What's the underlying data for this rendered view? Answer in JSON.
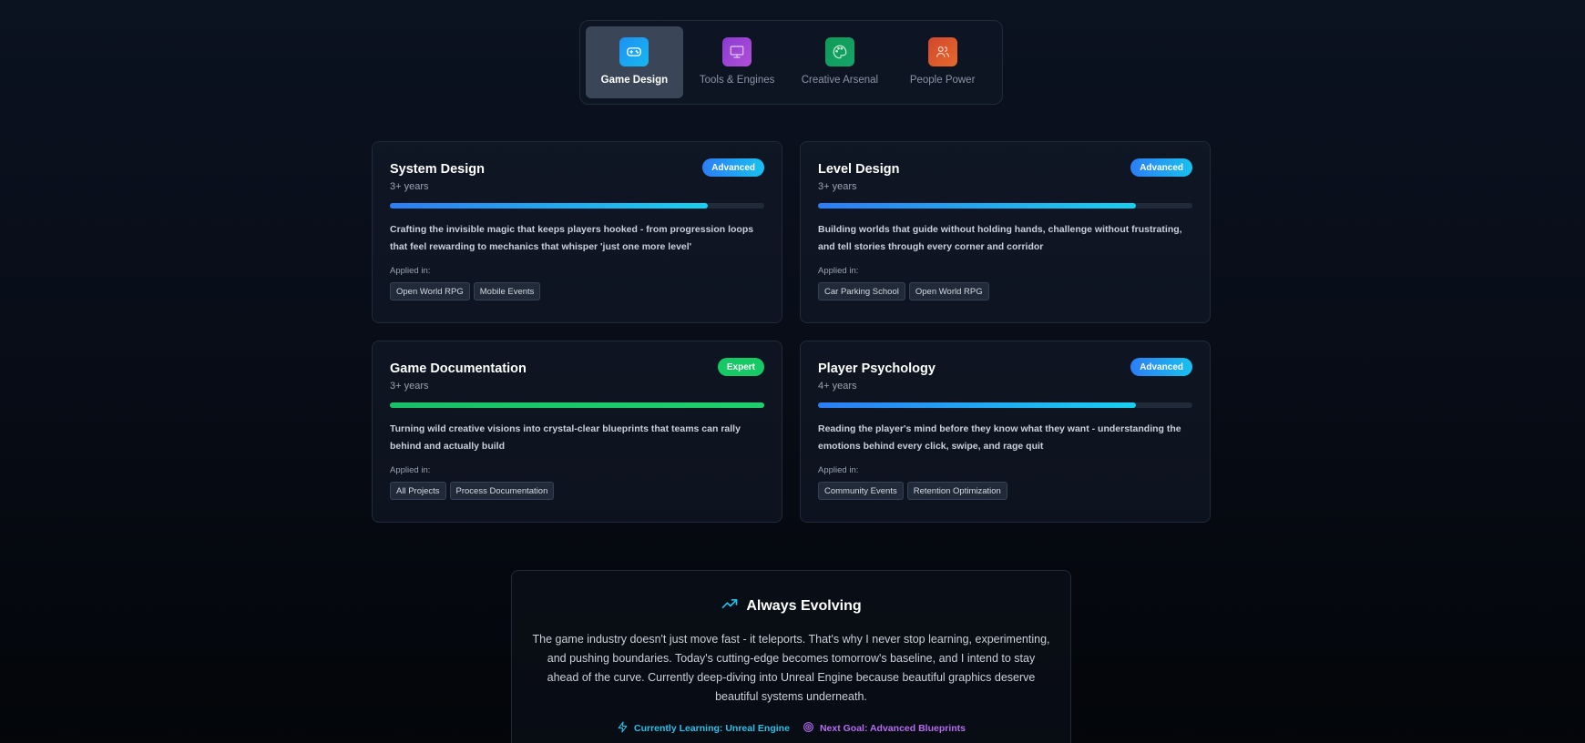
{
  "tabs": [
    {
      "label": "Game Design",
      "icon": "gamepad-icon",
      "color_from": "#1e90f5",
      "color_to": "#17b8ee",
      "active": true
    },
    {
      "label": "Tools & Engines",
      "icon": "monitor-icon",
      "color_from": "#8a3bd1",
      "color_to": "#b14fd8",
      "active": false
    },
    {
      "label": "Creative Arsenal",
      "icon": "palette-icon",
      "color_from": "#0f9a55",
      "color_to": "#15a56a",
      "active": false
    },
    {
      "label": "People Power",
      "icon": "users-icon",
      "color_from": "#d2462f",
      "color_to": "#e56a2a",
      "active": false
    }
  ],
  "skills": [
    {
      "title": "System Design",
      "years": "3+ years",
      "level": "Advanced",
      "progress": 0.85,
      "description": "Crafting the invisible magic that keeps players hooked - from progression loops that feel rewarding to mechanics that whisper 'just one more level'",
      "applied_label": "Applied in:",
      "tags": [
        "Open World RPG",
        "Mobile Events"
      ]
    },
    {
      "title": "Level Design",
      "years": "3+ years",
      "level": "Advanced",
      "progress": 0.85,
      "description": "Building worlds that guide without holding hands, challenge without frustrating, and tell stories through every corner and corridor",
      "applied_label": "Applied in:",
      "tags": [
        "Car Parking School",
        "Open World RPG"
      ]
    },
    {
      "title": "Game Documentation",
      "years": "3+ years",
      "level": "Expert",
      "progress": 1.0,
      "description": "Turning wild creative visions into crystal-clear blueprints that teams can rally behind and actually build",
      "applied_label": "Applied in:",
      "tags": [
        "All Projects",
        "Process Documentation"
      ]
    },
    {
      "title": "Player Psychology",
      "years": "4+ years",
      "level": "Advanced",
      "progress": 0.85,
      "description": "Reading the player's mind before they know what they want - understanding the emotions behind every click, swipe, and rage quit",
      "applied_label": "Applied in:",
      "tags": [
        "Community Events",
        "Retention Optimization"
      ]
    }
  ],
  "evolving": {
    "title": "Always Evolving",
    "text": "The game industry doesn't just move fast - it teleports. That's why I never stop learning, experimenting, and pushing boundaries. Today's cutting-edge becomes tomorrow's baseline, and I intend to stay ahead of the curve. Currently deep-diving into Unreal Engine because beautiful graphics deserve beautiful systems underneath.",
    "learning": "Currently Learning: Unreal Engine",
    "goal": "Next Goal: Advanced Blueprints"
  }
}
